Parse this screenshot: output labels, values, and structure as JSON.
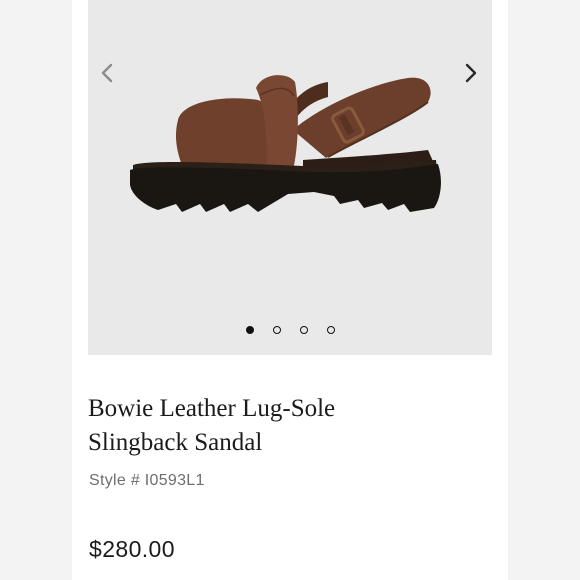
{
  "gallery": {
    "image_alt": "Bowie Leather Lug-Sole Slingback Sandal",
    "prev_icon": "chevron-left-icon",
    "next_icon": "chevron-right-icon",
    "slide_count": 4,
    "active_slide": 1,
    "colors": {
      "leather": "#6b3f2c",
      "sole": "#1a1612",
      "background": "#e9e9e9",
      "buckle": "#8a5a3c"
    }
  },
  "product": {
    "title_line1": "Bowie Leather Lug-Sole",
    "title_line2": "Slingback Sandal",
    "style_label": "Style #",
    "style_number": "I0593L1",
    "price": "$280.00"
  }
}
